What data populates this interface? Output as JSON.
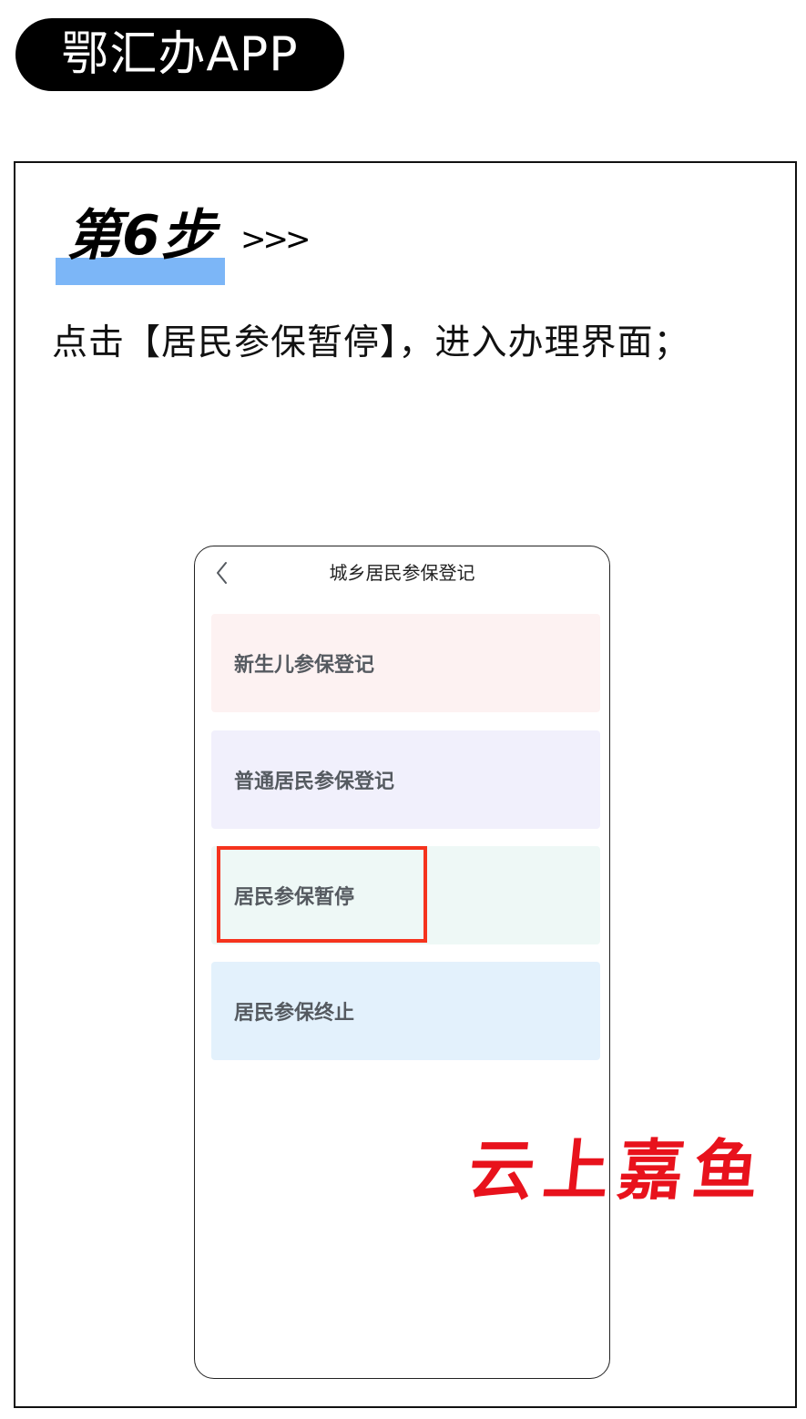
{
  "badge": {
    "app_name": "鄂汇办APP"
  },
  "step": {
    "title": "第6步",
    "arrows": ">>>"
  },
  "instruction": "点击【居民参保暂停】，进入办理界面；",
  "phone": {
    "header": {
      "title": "城乡居民参保登记",
      "back_icon": "chevron-left-icon"
    },
    "items": [
      {
        "label": "新生儿参保登记"
      },
      {
        "label": "普通居民参保登记"
      },
      {
        "label": "居民参保暂停"
      },
      {
        "label": "居民参保终止"
      }
    ],
    "highlight_color": "#f5331d"
  },
  "watermark": "云上嘉鱼",
  "colors": {
    "accent": "#7cb6f7",
    "watermark": "#e8121c"
  }
}
